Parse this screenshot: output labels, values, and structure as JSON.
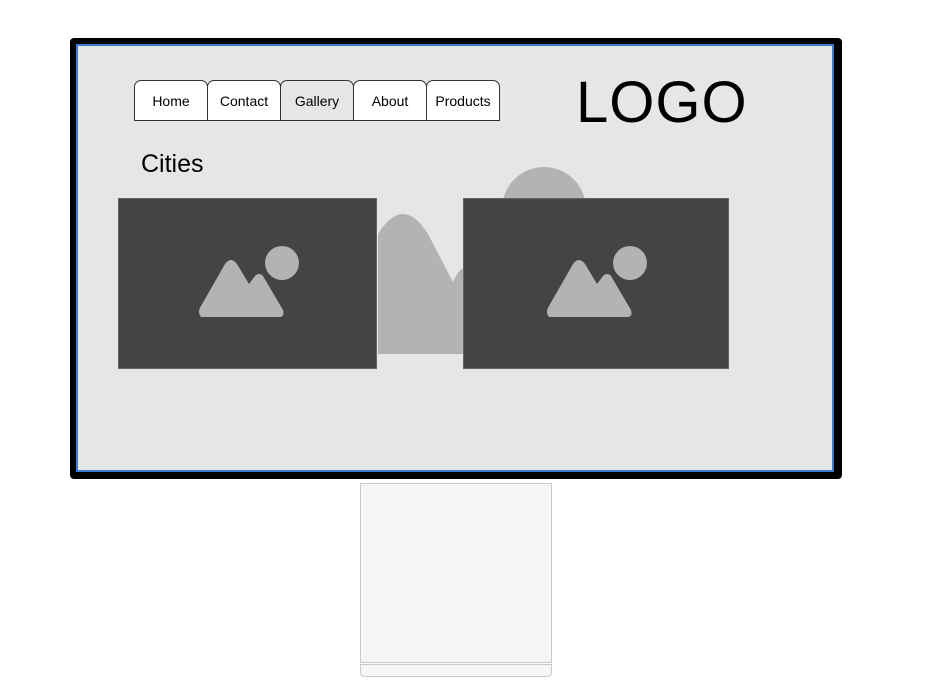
{
  "nav": {
    "tabs": [
      {
        "label": "Home",
        "active": false
      },
      {
        "label": "Contact",
        "active": false
      },
      {
        "label": "Gallery",
        "active": true
      },
      {
        "label": "About",
        "active": false
      },
      {
        "label": "Products",
        "active": false
      }
    ]
  },
  "logo": {
    "text": "LOGO"
  },
  "page": {
    "heading": "Cities"
  },
  "images": [
    {
      "icon": "image-placeholder-icon"
    },
    {
      "icon": "image-placeholder-icon"
    }
  ],
  "colors": {
    "screen_bg": "#e6e6e6",
    "screen_border": "#3b7bd1",
    "image_bg": "#444444",
    "image_icon": "#b3b3b3",
    "frame": "#000000"
  }
}
